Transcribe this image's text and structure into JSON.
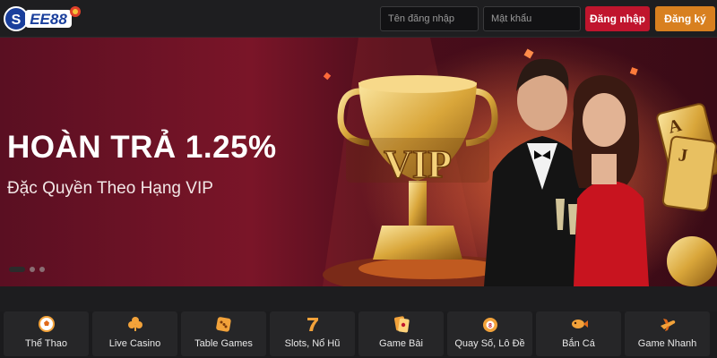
{
  "header": {
    "logo_text": "EE88",
    "username_placeholder": "Tên đăng nhập",
    "password_placeholder": "Mật khẩu",
    "login_label": "Đăng nhập",
    "register_label": "Đăng ký"
  },
  "banner": {
    "title": "HOÀN TRẢ 1.25%",
    "subtitle": "Đặc Quyền Theo Hạng VIP",
    "trophy_text": "VIP",
    "slide_count": 3,
    "active_slide": 1
  },
  "categories": [
    {
      "label": "Thể Thao",
      "icon": "soccer-ball-icon"
    },
    {
      "label": "Live Casino",
      "icon": "club-card-icon"
    },
    {
      "label": "Table Games",
      "icon": "dice-icon"
    },
    {
      "label": "Slots, Nổ Hũ",
      "icon": "slot-seven-icon"
    },
    {
      "label": "Game Bài",
      "icon": "playing-card-icon"
    },
    {
      "label": "Quay Số, Lô Đề",
      "icon": "lottery-ball-icon"
    },
    {
      "label": "Bắn Cá",
      "icon": "fish-icon"
    },
    {
      "label": "Game Nhanh",
      "icon": "rocket-plane-icon"
    }
  ],
  "colors": {
    "login_button": "#c0152d",
    "register_button": "#d8801f",
    "banner_bg": "#6a1226",
    "page_bg": "#1b1b1d"
  }
}
